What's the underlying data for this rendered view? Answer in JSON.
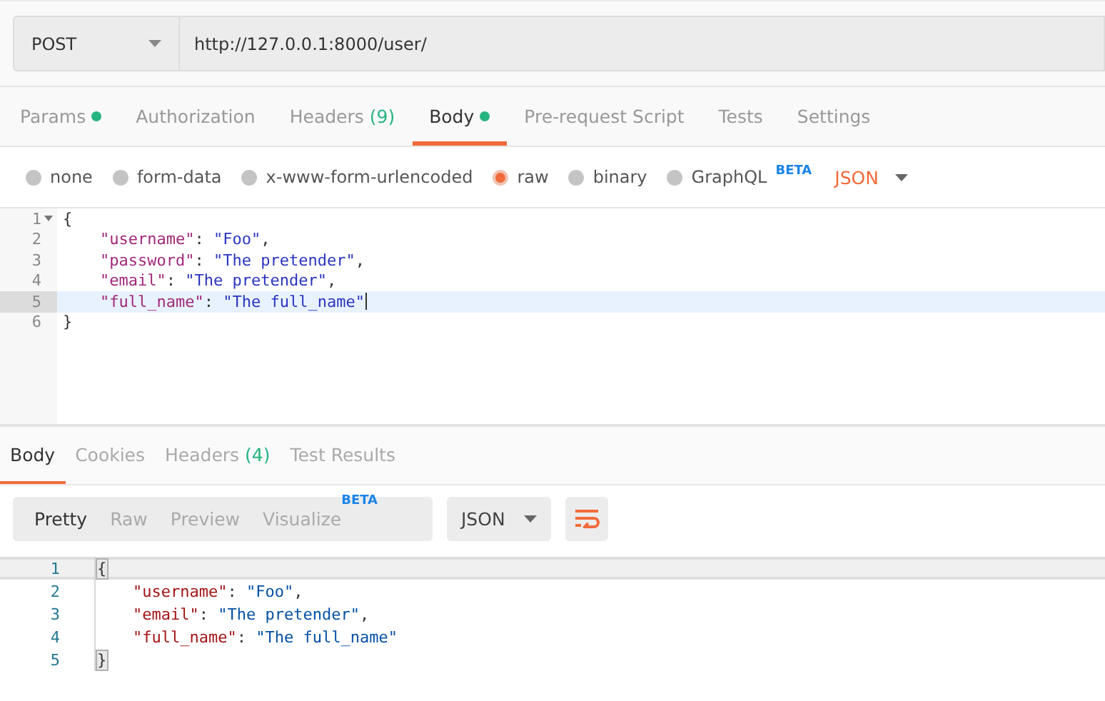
{
  "request": {
    "method": "POST",
    "url": "http://127.0.0.1:8000/user/"
  },
  "request_tabs": [
    {
      "label": "Params",
      "dot": true,
      "selected": false
    },
    {
      "label": "Authorization",
      "dot": false,
      "selected": false
    },
    {
      "label": "Headers",
      "count": "(9)",
      "dot": false,
      "selected": false
    },
    {
      "label": "Body",
      "dot": true,
      "selected": true
    },
    {
      "label": "Pre-request Script",
      "dot": false,
      "selected": false
    },
    {
      "label": "Tests",
      "dot": false,
      "selected": false
    },
    {
      "label": "Settings",
      "dot": false,
      "selected": false
    }
  ],
  "body_types": [
    {
      "label": "none",
      "selected": false
    },
    {
      "label": "form-data",
      "selected": false
    },
    {
      "label": "x-www-form-urlencoded",
      "selected": false
    },
    {
      "label": "raw",
      "selected": true
    },
    {
      "label": "binary",
      "selected": false
    },
    {
      "label": "GraphQL",
      "badge": "BETA",
      "selected": false
    }
  ],
  "body_format": "JSON",
  "request_editor": [
    {
      "number": "1",
      "foldable": true,
      "active": false,
      "indented": false,
      "tokens": [
        {
          "kind": "punct",
          "text": "{"
        }
      ]
    },
    {
      "number": "2",
      "foldable": false,
      "active": false,
      "indented": true,
      "tokens": [
        {
          "kind": "key",
          "text": "\"username\""
        },
        {
          "kind": "punct",
          "text": ": "
        },
        {
          "kind": "string",
          "text": "\"Foo\""
        },
        {
          "kind": "punct",
          "text": ","
        }
      ]
    },
    {
      "number": "3",
      "foldable": false,
      "active": false,
      "indented": true,
      "tokens": [
        {
          "kind": "key",
          "text": "\"password\""
        },
        {
          "kind": "punct",
          "text": ": "
        },
        {
          "kind": "string",
          "text": "\"The pretender\""
        },
        {
          "kind": "punct",
          "text": ","
        }
      ]
    },
    {
      "number": "4",
      "foldable": false,
      "active": false,
      "indented": true,
      "tokens": [
        {
          "kind": "key",
          "text": "\"email\""
        },
        {
          "kind": "punct",
          "text": ": "
        },
        {
          "kind": "string",
          "text": "\"The pretender\""
        },
        {
          "kind": "punct",
          "text": ","
        }
      ]
    },
    {
      "number": "5",
      "foldable": false,
      "active": true,
      "indented": true,
      "tokens": [
        {
          "kind": "key",
          "text": "\"full_name\""
        },
        {
          "kind": "punct",
          "text": ": "
        },
        {
          "kind": "string",
          "text": "\"The full_name\""
        }
      ]
    },
    {
      "number": "6",
      "foldable": false,
      "active": false,
      "indented": false,
      "tokens": [
        {
          "kind": "punct",
          "text": "}"
        }
      ]
    }
  ],
  "response_tabs": [
    {
      "label": "Body",
      "selected": true
    },
    {
      "label": "Cookies",
      "selected": false
    },
    {
      "label": "Headers",
      "count": "(4)",
      "selected": false
    },
    {
      "label": "Test Results",
      "selected": false
    }
  ],
  "view_modes": [
    {
      "label": "Pretty",
      "selected": true
    },
    {
      "label": "Raw",
      "selected": false
    },
    {
      "label": "Preview",
      "selected": false
    },
    {
      "label": "Visualize",
      "badge": "BETA",
      "selected": false
    }
  ],
  "response_format": "JSON",
  "response_editor": [
    {
      "number": "1",
      "active": true,
      "indented": false,
      "tokens": [
        {
          "kind": "bracket",
          "text": "{"
        }
      ]
    },
    {
      "number": "2",
      "active": false,
      "indented": true,
      "tokens": [
        {
          "kind": "key",
          "text": "\"username\""
        },
        {
          "kind": "punct",
          "text": ": "
        },
        {
          "kind": "string",
          "text": "\"Foo\""
        },
        {
          "kind": "punct",
          "text": ","
        }
      ]
    },
    {
      "number": "3",
      "active": false,
      "indented": true,
      "tokens": [
        {
          "kind": "key",
          "text": "\"email\""
        },
        {
          "kind": "punct",
          "text": ": "
        },
        {
          "kind": "string",
          "text": "\"The pretender\""
        },
        {
          "kind": "punct",
          "text": ","
        }
      ]
    },
    {
      "number": "4",
      "active": false,
      "indented": true,
      "tokens": [
        {
          "kind": "key",
          "text": "\"full_name\""
        },
        {
          "kind": "punct",
          "text": ": "
        },
        {
          "kind": "string",
          "text": "\"The full_name\""
        }
      ]
    },
    {
      "number": "5",
      "active": false,
      "indented": false,
      "tokens": [
        {
          "kind": "bracket",
          "text": "}"
        }
      ]
    }
  ]
}
